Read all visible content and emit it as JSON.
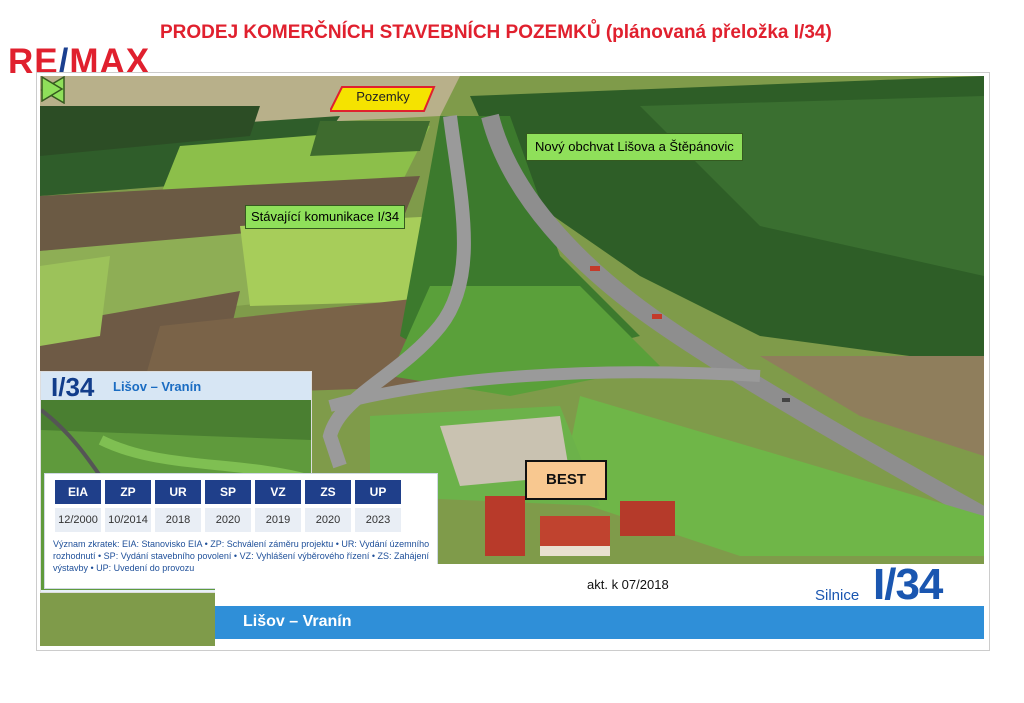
{
  "header": {
    "brand_left": "RE",
    "brand_slash": "/",
    "brand_right": "MAX",
    "title": "PRODEJ KOMERČNÍCH STAVEBNÍCH POZEMKŮ  (plánovaná přeložka I/34)"
  },
  "labels": {
    "pozemky": "Pozemky",
    "obchvat": "Nový obchvat Lišova a Štěpánovic",
    "stavajici": "Stávající komunikace I/34",
    "best": "BEST"
  },
  "inset": {
    "code": "I/34",
    "route": "Lišov – Vranín"
  },
  "milestones": {
    "headers": [
      "EIA",
      "ZP",
      "UR",
      "SP",
      "VZ",
      "ZS",
      "UP"
    ],
    "values": [
      "12/2000",
      "10/2014",
      "2018",
      "2020",
      "2019",
      "2020",
      "2023"
    ],
    "legend": "Význam zkratek: EIA: Stanovisko EIA • ZP: Schválení záměru projektu • UR: Vydání územního rozhodnutí • SP: Vydání stavebního povolení • VZ: Vyhlášení výběrového řízení • ZS: Zahájení výstavby • UP: Uvedení do provozu"
  },
  "banner": {
    "akt": "akt. k 07/2018",
    "silnice": "Silnice",
    "code": "I/34",
    "route": "Lišov – Vranín"
  },
  "colors": {
    "brand_red": "#e0202e",
    "brand_blue": "#1b3f8f",
    "label_green": "#8fe05a",
    "pozemky_yellow": "#f5e300",
    "best_orange": "#f8c890",
    "road_blue": "#2f8fd8"
  }
}
